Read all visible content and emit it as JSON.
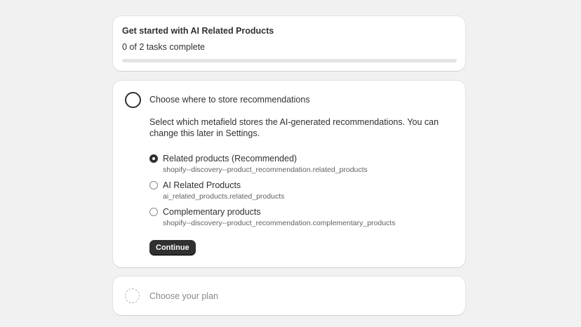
{
  "progress_card": {
    "title": "Get started with AI Related Products",
    "count_text": "0 of 2 tasks complete",
    "progress_fraction": 0
  },
  "step_card": {
    "title": "Choose where to store recommendations",
    "description": "Select which metafield stores the AI-generated recommendations. You can change this later in Settings.",
    "options": [
      {
        "label": "Related products (Recommended)",
        "metafield": "shopify--discovery--product_recommendation.related_products",
        "selected": true
      },
      {
        "label": "AI Related Products",
        "metafield": "ai_related_products.related_products",
        "selected": false
      },
      {
        "label": "Complementary products",
        "metafield": "shopify--discovery--product_recommendation.complementary_products",
        "selected": false
      }
    ],
    "continue_label": "Continue"
  },
  "plan_card": {
    "title": "Choose your plan"
  }
}
